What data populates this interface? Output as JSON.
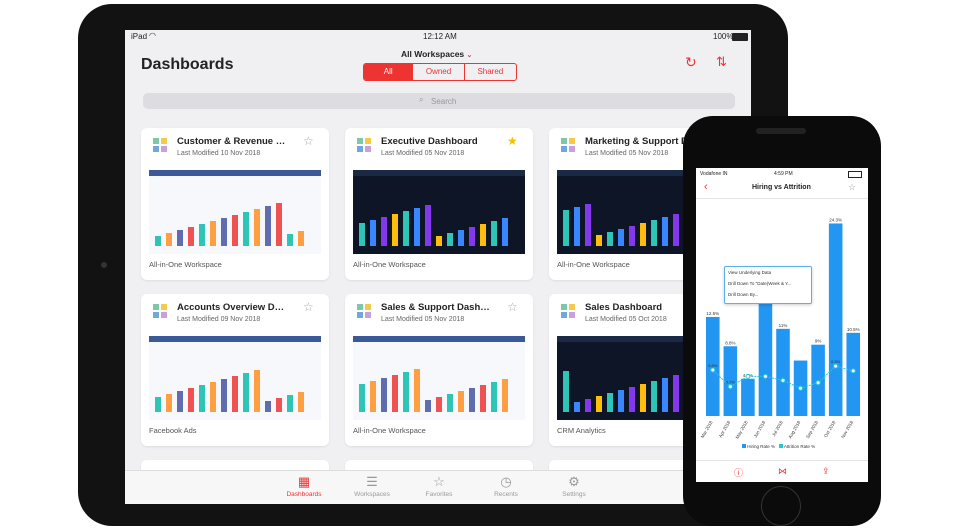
{
  "ipad": {
    "status": {
      "device": "iPad",
      "time": "12:12 AM",
      "battery": "100%"
    },
    "title": "Dashboards",
    "workspace_selector": "All Workspaces",
    "segments": [
      "All",
      "Owned",
      "Shared"
    ],
    "search_placeholder": "Search",
    "cards": [
      {
        "title": "Customer & Revenue D...",
        "modified": "Last Modified 10 Nov 2018",
        "workspace": "All-in-One Workspace",
        "starred": false,
        "theme": "light"
      },
      {
        "title": "Executive Dashboard",
        "modified": "Last Modified 05 Nov 2018",
        "workspace": "All-in-One Workspace",
        "starred": true,
        "theme": "dark"
      },
      {
        "title": "Marketing & Support D",
        "modified": "Last Modified 05 Nov 2018",
        "workspace": "All-in-One Workspace",
        "starred": false,
        "theme": "dark"
      },
      {
        "title": "Accounts Overview Da...",
        "modified": "Last Modified 09 Nov 2018",
        "workspace": "Facebook Ads",
        "starred": false,
        "theme": "light"
      },
      {
        "title": "Sales & Support Dashb...",
        "modified": "Last Modified 05 Nov 2018",
        "workspace": "All-in-One Workspace",
        "starred": false,
        "theme": "light"
      },
      {
        "title": "Sales Dashboard",
        "modified": "Last Modified 05 Oct 2018",
        "workspace": "CRM Analytics",
        "starred": false,
        "theme": "dark"
      }
    ],
    "tabs": [
      "Dashboards",
      "Workspaces",
      "Favorites",
      "Recents",
      "Settings"
    ],
    "accent_color": "#e8312f"
  },
  "phone": {
    "status": {
      "carrier": "Vodafone IN",
      "time": "4:59 PM"
    },
    "title": "Hiring vs Attrition",
    "menu": [
      "View Underlying Data",
      "Drill Down To \"Date(Week & Y...",
      "Drill Down By..."
    ],
    "legend": [
      "Hiring Rate %",
      "Attrition Rate %"
    ]
  },
  "chart_data": {
    "type": "bar",
    "categories": [
      "Mar 2018",
      "Apr 2018",
      "May 2018",
      "Jun 2018",
      "Jul 2018",
      "Aug 2018",
      "Sep 2018",
      "Oct 2018",
      "Nov 2018"
    ],
    "series": [
      {
        "name": "Hiring Rate %",
        "values": [
          12.5,
          8.8,
          4.7,
          16.0,
          11.0,
          7.0,
          9.0,
          24.3,
          10.5
        ],
        "labels": [
          "12.5%",
          "8.8%",
          "4.7%",
          "",
          "11%",
          "",
          "9%",
          "24.3%",
          "10.5%"
        ]
      },
      {
        "name": "Attrition Rate %",
        "values": [
          5.8,
          3.7,
          5.0,
          5.0,
          4.5,
          3.5,
          4.2,
          6.3,
          5.7
        ],
        "labels": [
          "5.8%",
          "3.7%",
          "",
          "",
          "",
          "",
          "",
          "6.3%",
          ""
        ]
      }
    ],
    "ylim": [
      0,
      26
    ]
  }
}
